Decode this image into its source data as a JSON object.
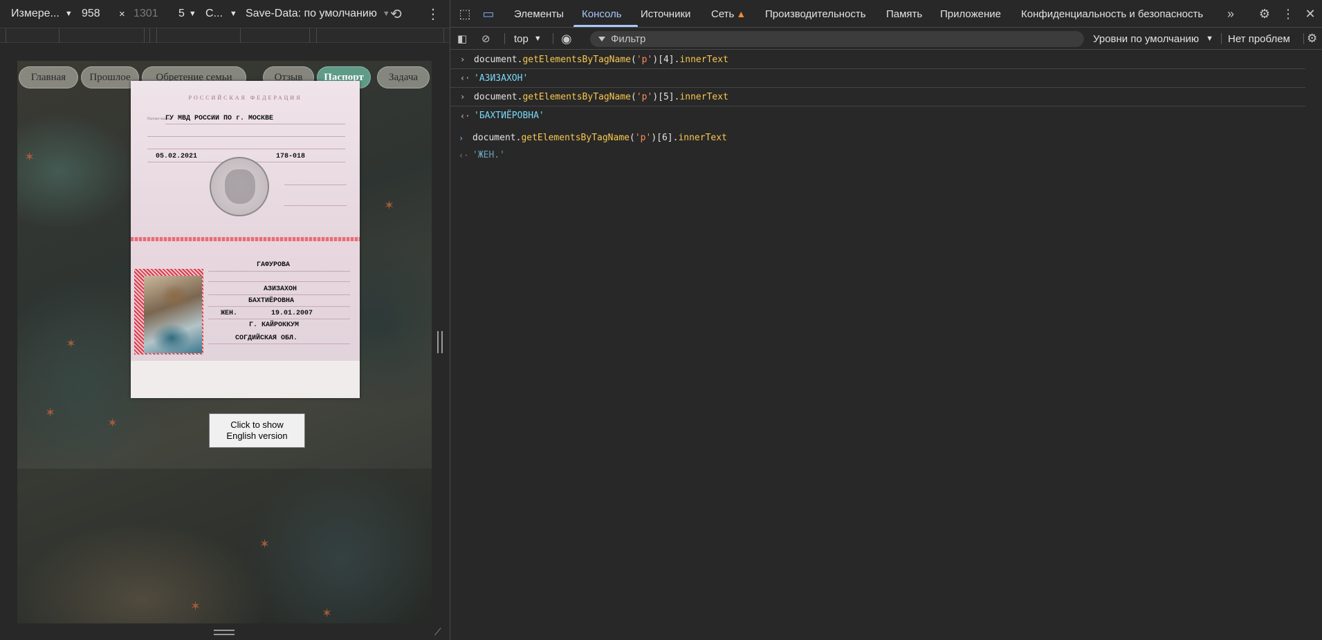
{
  "device_toolbar": {
    "device_name": "Измере...",
    "width": "958",
    "times": "×",
    "height": "1301",
    "zoom": "5",
    "throttle": "С...",
    "save_data": "Save-Data: по умолчанию"
  },
  "site": {
    "nav": [
      "Главная",
      "Прошлое",
      "Обретение семьи",
      "Отзыв",
      "Паспорт",
      "Задача"
    ],
    "active_nav": "Паспорт",
    "english_button": [
      "Click to show",
      "English version"
    ],
    "passport": {
      "header": "РОССИЙСКАЯ ФЕДЕРАЦИЯ",
      "issued_by": "ГУ МВД РОССИИ ПО г. МОСКВЕ",
      "issue_date": "05.02.2021",
      "department_code": "178-018",
      "surname": "ГАФУРОВА",
      "given_name": "АЗИЗАХОН",
      "patronymic": "БАХТИЁРОВНА",
      "sex": "ЖЕН.",
      "birth_date": "19.01.2007",
      "birth_place_1": "Г. КАЙРОККУМ",
      "birth_place_2": "СОГДИЙСКАЯ ОБЛ."
    }
  },
  "devtools": {
    "tabs": [
      "Элементы",
      "Консоль",
      "Источники",
      "Сеть",
      "Производительность",
      "Память",
      "Приложение",
      "Конфиденциальность и безопасность"
    ],
    "active_tab": "Консоль",
    "more_tabs": "»",
    "console_bar": {
      "context": "top",
      "filter_placeholder": "Фильтр",
      "levels": "Уровни по умолчанию",
      "issues": "Нет проблем"
    },
    "console": [
      {
        "type": "input",
        "prefix": "document.",
        "method": "getElementsByTagName",
        "open": "(",
        "arg": "'p'",
        "close": ")[4].",
        "prop": "innerText"
      },
      {
        "type": "output",
        "value": "'АЗИЗАХОН'"
      },
      {
        "type": "input",
        "prefix": "document.",
        "method": "getElementsByTagName",
        "open": "(",
        "arg": "'p'",
        "close": ")[5].",
        "prop": "innerText"
      },
      {
        "type": "output",
        "value": "'БАХТИЁРОВНА'"
      },
      {
        "type": "input",
        "prefix": "document.",
        "method": "getElementsByTagName",
        "open": "(",
        "arg": "'p'",
        "close": ")[6].",
        "prop": "innerText"
      },
      {
        "type": "output",
        "value": "'ЖЕН.'"
      }
    ]
  },
  "colors": {
    "devtools_bg": "#282828",
    "active_tab": "#a8c7fa",
    "method": "#f9c74f",
    "string": "#fc8e59",
    "result": "#7ad9f8",
    "nav_active": "#5e9c88"
  }
}
